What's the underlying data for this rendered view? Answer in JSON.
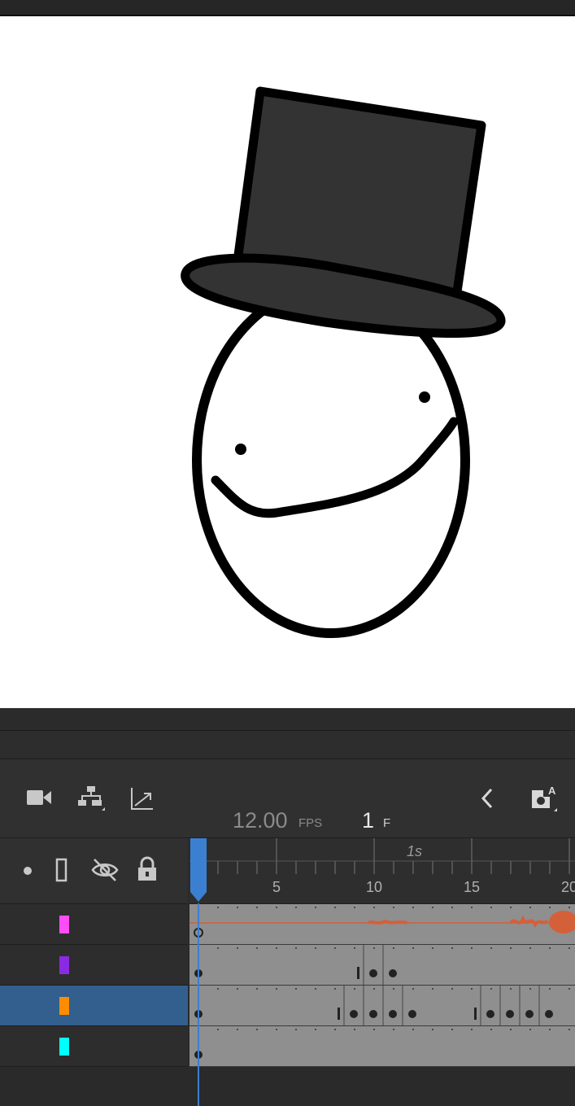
{
  "timeline": {
    "fps_value": "12.00",
    "fps_unit": "FPS",
    "current_frame": "1",
    "frame_unit": "F",
    "ruler": {
      "time_label": "1s",
      "frame_labels": [
        "5",
        "10",
        "15",
        "20"
      ]
    },
    "layers": [
      {
        "color": "#ff4df5",
        "selected": false
      },
      {
        "color": "#8a2be2",
        "selected": false
      },
      {
        "color": "#ff8c00",
        "selected": true
      },
      {
        "color": "#00ffff",
        "selected": false
      }
    ]
  },
  "icons": {
    "camera": "camera-icon",
    "hierarchy": "layer-parenting-icon",
    "graph": "graph-icon",
    "dot": "show-outline-dot-icon",
    "outline": "outline-icon",
    "eye": "hide-eye-icon",
    "lock": "lock-icon",
    "back": "chevron-left-icon",
    "edit_symbols": "edit-symbols-icon"
  }
}
